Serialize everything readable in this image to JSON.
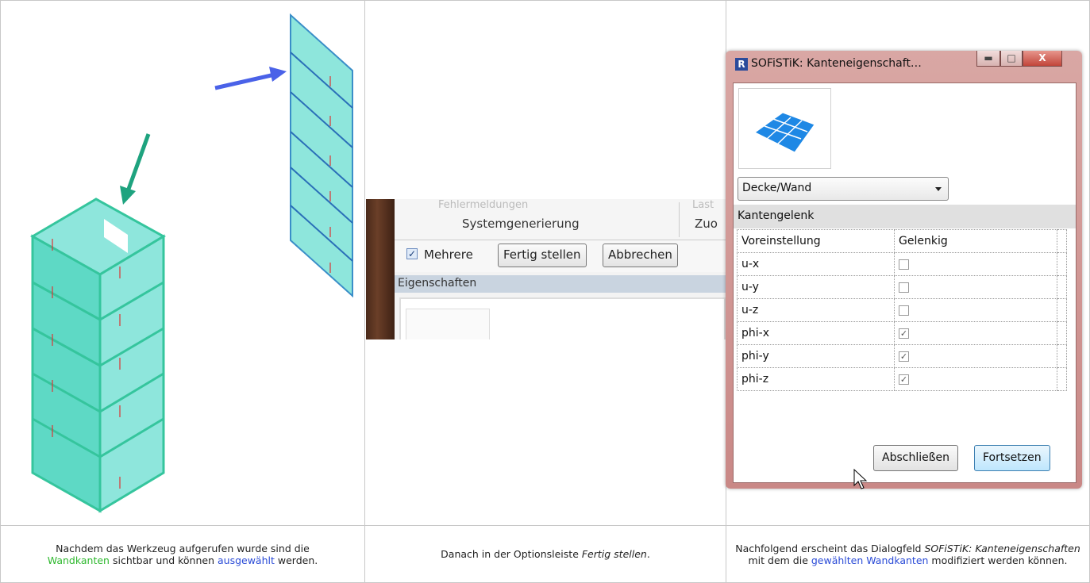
{
  "option_bar": {
    "faded_1": "Fehlermeldungen",
    "faded_2": "Last",
    "group_1": "Systemgenerierung",
    "group_2": "Zuo",
    "checkbox_label": "Mehrere",
    "checked": true,
    "btn_finish": "Fertig stellen",
    "btn_cancel": "Abbrechen",
    "properties_label": "Eigenschaften"
  },
  "dialog": {
    "app_icon": "R",
    "title": "SOFiSTiK: Kanteneigenschaft…",
    "window_buttons": [
      "minimize-icon",
      "maximize-icon",
      "close-icon"
    ],
    "combo_value": "Decke/Wand",
    "section": "Kantengelenk",
    "col_1": "Voreinstellung",
    "col_2": "Gelenkig",
    "rows": [
      {
        "name": "u-x",
        "checked": false
      },
      {
        "name": "u-y",
        "checked": false
      },
      {
        "name": "u-z",
        "checked": false
      },
      {
        "name": "phi-x",
        "checked": true
      },
      {
        "name": "phi-y",
        "checked": true
      },
      {
        "name": "phi-z",
        "checked": true
      }
    ],
    "btn_close": "Abschließen",
    "btn_continue": "Fortsetzen"
  },
  "captions": {
    "c1_a": "Nachdem das Werkzeug aufgerufen wurde sind die",
    "c1_link1": "Wandkanten",
    "c1_b": " sichtbar und können ",
    "c1_link2": "ausgewählt",
    "c1_c": " werden.",
    "c2_a": "Danach in der Optionsleiste ",
    "c2_em": "Fertig stellen",
    "c2_b": ".",
    "c3_a": "Nachfolgend erscheint das Dialogfeld ",
    "c3_em": "SOFiSTiK: Kanteneigenschaften",
    "c3_b": " mit dem die ",
    "c3_link": "gewählten Wandkanten",
    "c3_c": " modifiziert werden können."
  },
  "colors": {
    "green_link": "#2eb82e",
    "blue_link": "#2a4bd7",
    "wall": "#6fded3"
  }
}
